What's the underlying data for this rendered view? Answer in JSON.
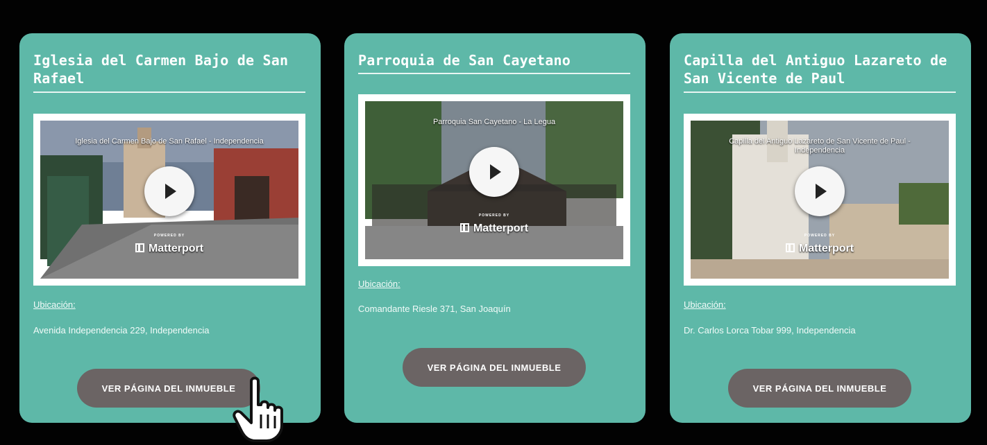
{
  "cards": [
    {
      "title": "Iglesia del Carmen Bajo de San Rafael",
      "video_title": "Iglesia del Carmen Bajo de San Rafael - Independencia",
      "powered_by": "POWERED BY",
      "brand": "Matterport",
      "location_label": "Ubicación:",
      "address": "Avenida Independencia 229, Independencia",
      "button_label": "VER PÁGINA DEL INMUEBLE"
    },
    {
      "title": "Parroquia de San Cayetano",
      "video_title": "Parroquia San Cayetano - La Legua",
      "powered_by": "POWERED BY",
      "brand": "Matterport",
      "location_label": "Ubicación:",
      "address": "Comandante Riesle 371, San Joaquín",
      "button_label": "VER PÁGINA DEL INMUEBLE"
    },
    {
      "title": "Capilla del Antiguo Lazareto de San Vicente de Paul",
      "video_title": "Capilla del Antiguo Lazareto de San Vicente de Paul - Independencia",
      "powered_by": "POWERED BY",
      "brand": "Matterport",
      "location_label": "Ubicación:",
      "address": "Dr. Carlos Lorca Tobar 999, Independencia",
      "button_label": "VER PÁGINA DEL INMUEBLE"
    }
  ],
  "colors": {
    "background": "#020202",
    "card": "#5eb8a8",
    "button": "#6b6464",
    "text": "#ffffff"
  },
  "icons": [
    "play-icon",
    "matterport-logo-icon",
    "hand-pointer-cursor-icon"
  ]
}
